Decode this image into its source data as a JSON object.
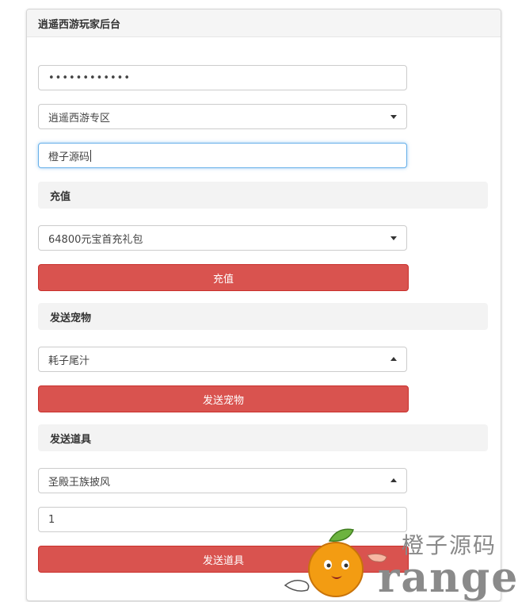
{
  "panel": {
    "title": "逍遥西游玩家后台"
  },
  "form": {
    "password_value": "••••••••••••",
    "server_selected": "逍遥西游专区",
    "player_name_value": "橙子源码"
  },
  "recharge": {
    "section_title": "充值",
    "package_selected": "64800元宝首充礼包",
    "button_label": "充值"
  },
  "pet": {
    "section_title": "发送宠物",
    "pet_selected": "耗子尾汁",
    "button_label": "发送宠物"
  },
  "item": {
    "section_title": "发送道具",
    "item_selected": "圣殿王族披风",
    "quantity_value": "1",
    "button_label": "发送道具"
  },
  "watermark": {
    "text_cn": "橙子源码",
    "text_en": "range",
    "colors": {
      "orange": "#f39c12",
      "gray": "#8a8a8a"
    }
  },
  "colors": {
    "danger": "#d9534f",
    "focus": "#66afe9"
  }
}
